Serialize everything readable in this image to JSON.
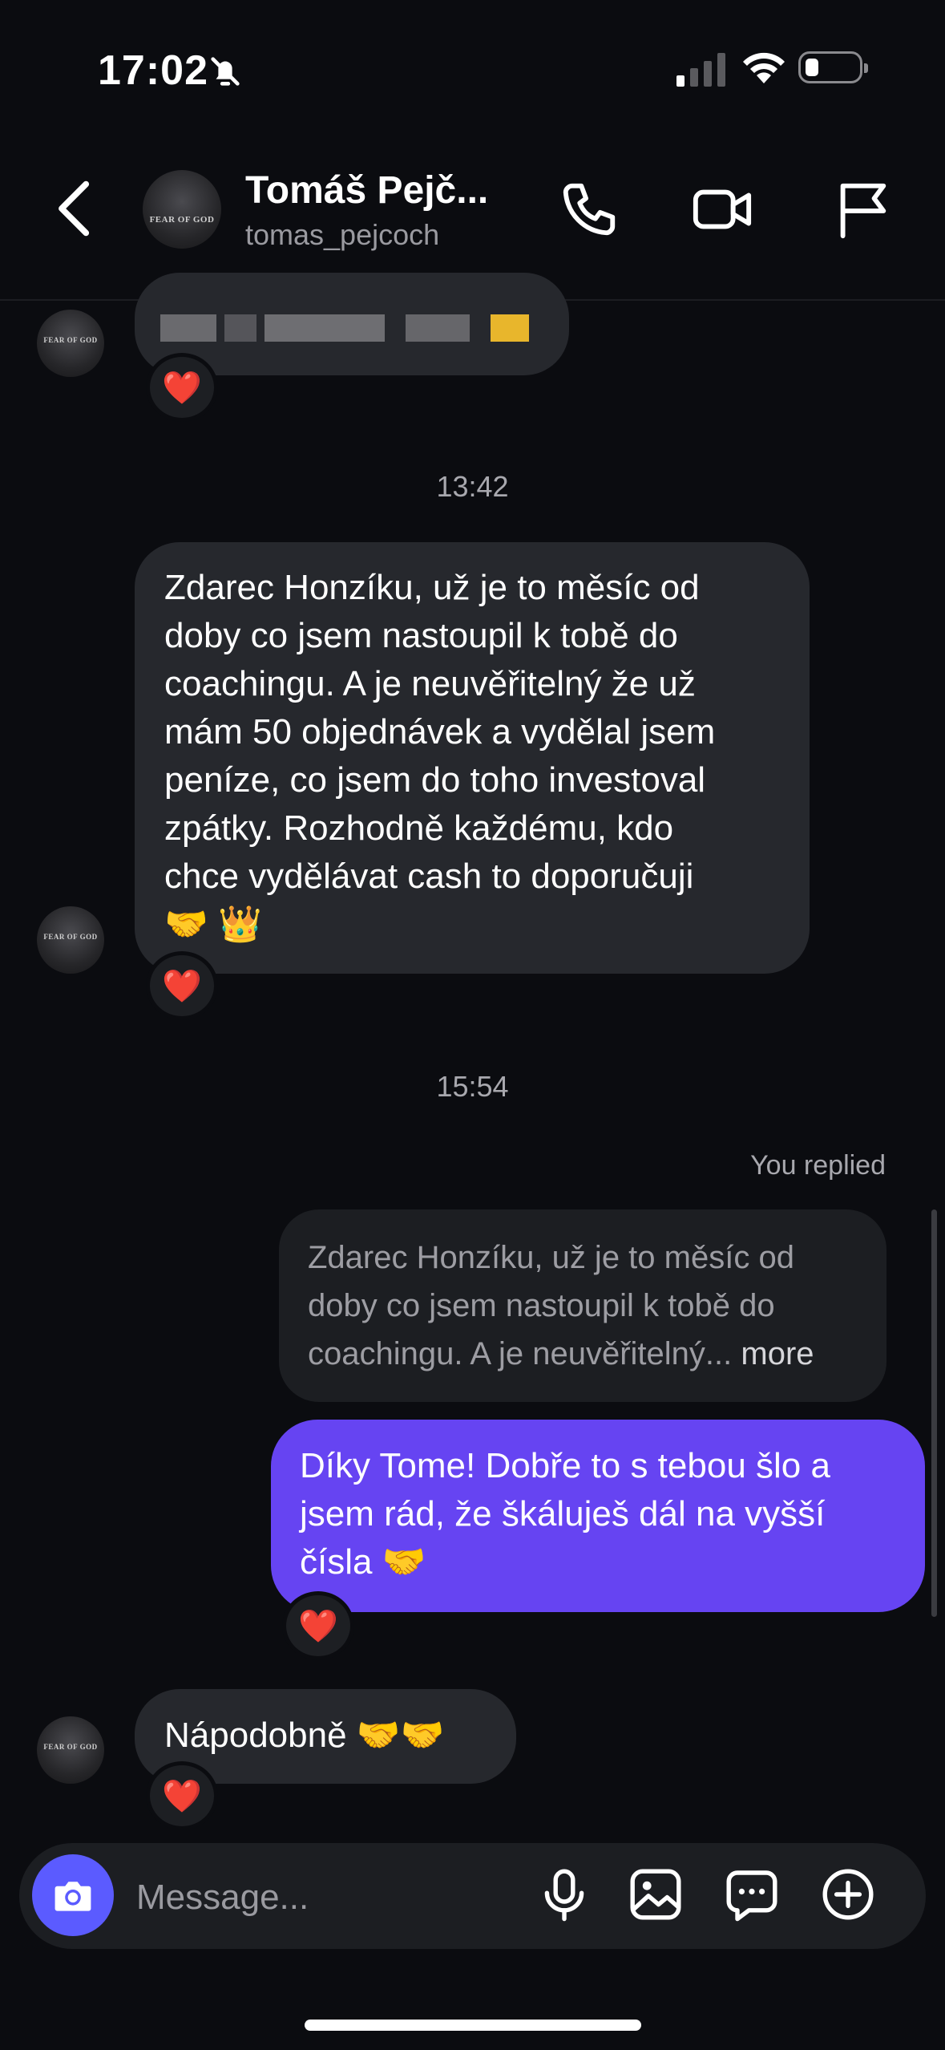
{
  "status_bar": {
    "time": "17:02"
  },
  "header": {
    "name": "Tomáš Pejč...",
    "username": "tomas_pejcoch",
    "avatar_text": "FEAR OF GOD"
  },
  "messages": {
    "first_reaction": "❤️",
    "stamp_1": "13:42",
    "msg_1_line_1": "Zdarec Honzíku, už je to měsíc od",
    "msg_1_line_2": "doby co jsem nastoupil k tobě do",
    "msg_1_line_3": "coachingu. A je neuvěřitelný že už",
    "msg_1_line_4": "mám 50 objednávek a vydělal jsem",
    "msg_1_line_5": "peníze, co jsem do toho investoval",
    "msg_1_line_6": "zpátky. Rozhodně každému, kdo",
    "msg_1_line_7": "chce vydělávat cash to doporučuji",
    "msg_1_line_8": "🤝 👑",
    "msg_1_reaction": "❤️",
    "stamp_2": "15:54",
    "you_replied": "You replied",
    "quote_line_1": "Zdarec Honzíku, už je to měsíc od",
    "quote_line_2": "doby co jsem nastoupil k tobě do",
    "quote_line_3": "coachingu. A je neuvěřitelný...",
    "quote_more": "more",
    "reply_line_1": "Díky Tome! Dobře to s tebou šlo a",
    "reply_line_2": "jsem rád, že škáluješ dál na vyšší",
    "reply_line_3": "čísla 🤝",
    "reply_reaction": "❤️",
    "msg_3": "Nápodobně 🤝🤝",
    "msg_3_reaction": "❤️"
  },
  "composer": {
    "placeholder": "Message..."
  },
  "colors": {
    "background": "#0b0c10",
    "incoming_bubble": "#26282d",
    "outgoing_bubble": "#6644f2",
    "accent": "#5b5bff"
  },
  "icons": [
    "bell-slash-icon",
    "signal-icon",
    "wifi-icon",
    "battery-icon",
    "back-chevron-icon",
    "phone-icon",
    "video-icon",
    "flag-icon",
    "camera-icon",
    "microphone-icon",
    "image-icon",
    "sticker-icon",
    "plus-circle-icon"
  ]
}
